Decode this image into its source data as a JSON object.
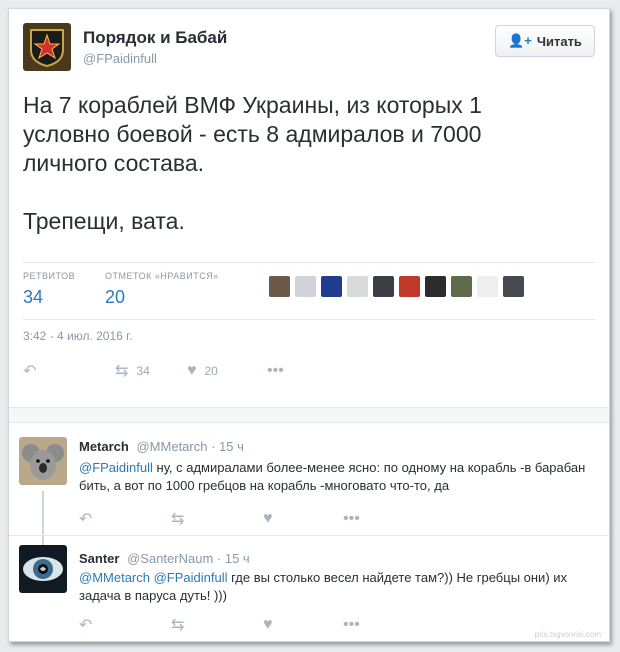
{
  "author": {
    "name": "Порядок и Бабай",
    "handle": "@FPaidinfull"
  },
  "follow_label": "Читать",
  "tweet": {
    "text": "На 7 кораблей ВМФ Украины, из которых 1\nусловно боевой - есть 8 адмиралов и 7000\nличного состава.\n\nТрепещи, вата.",
    "retweets_label": "РЕТВИТОВ",
    "retweets": "34",
    "likes_label": "ОТМЕТОК «НРАВИТСЯ»",
    "likes": "20",
    "timestamp": "3:42 - 4 июл. 2016 г.",
    "action_retweets": "34",
    "action_likes": "20"
  },
  "liker_colors": [
    "#6b5a4a",
    "#d0d4d8",
    "#1f3c8f",
    "#d8dadc",
    "#3a3f45",
    "#c0392b",
    "#2c2c2c",
    "#5d6b4a",
    "#eeeeee",
    "#444a4f"
  ],
  "replies": [
    {
      "name": "Metarch",
      "handle": "@MMetarch",
      "time": "· 15 ч",
      "mention": "@FPaidinfull",
      "text": " ну, с адмиралами более-менее ясно: по одному на корабль -в барабан бить, а вот по 1000 гребцов на корабль -многовато что-то, да"
    },
    {
      "name": "Santer",
      "handle": "@SanterNaum",
      "time": "· 15 ч",
      "mention": "@MMetarch @FPaidinfull",
      "text": " где вы столько весел найдете там?)) Не гребцы они) их задача в паруса дуть! )))"
    }
  ],
  "watermark": "pris.tsgvonrisi.com",
  "colors": {
    "accent": "#2b7bb9",
    "muted": "#8899a6",
    "text": "#292f33"
  }
}
